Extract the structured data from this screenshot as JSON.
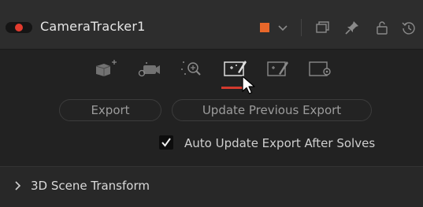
{
  "header": {
    "node_name": "CameraTracker1",
    "node_color": "#e8672a",
    "icons": [
      "toggle-enable",
      "color-swatch",
      "chevron-down-icon",
      "window-icon",
      "pin-icon",
      "lock-icon",
      "reset-icon"
    ]
  },
  "tabs": {
    "items": [
      "track-tab-icon",
      "camera-tab-icon",
      "solve-tab-icon",
      "export-tab-icon",
      "edit-tab-icon",
      "options-tab-icon"
    ],
    "active": "export-tab-icon"
  },
  "buttons": {
    "export": "Export",
    "update_previous_export": "Update Previous Export"
  },
  "checkbox": {
    "label": "Auto Update Export After Solves",
    "checked": true
  },
  "section": {
    "label": "3D Scene Transform",
    "collapsed": true
  }
}
